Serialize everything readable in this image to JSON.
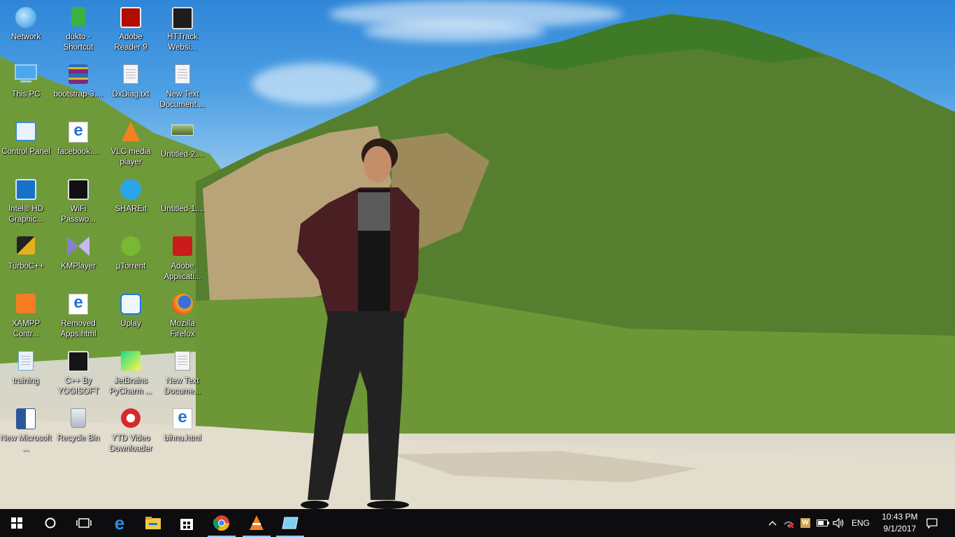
{
  "desktop": {
    "icons": [
      {
        "label": "Network"
      },
      {
        "label": "dukto - Shortcut"
      },
      {
        "label": "Adobe Reader 9"
      },
      {
        "label": "HTTrack Websi..."
      },
      {
        "label": "This PC"
      },
      {
        "label": "bootstrap-3...."
      },
      {
        "label": "DxDiag.txt"
      },
      {
        "label": "New Text Document...."
      },
      {
        "label": "Control Panel"
      },
      {
        "label": "facebook...."
      },
      {
        "label": "VLC media player"
      },
      {
        "label": "Untitled-2...."
      },
      {
        "label": "Intel® HD Graphic..."
      },
      {
        "label": "WiFi Passwo..."
      },
      {
        "label": "SHAREit"
      },
      {
        "label": "Untitled-1...."
      },
      {
        "label": "TurboC++"
      },
      {
        "label": "KMPlayer"
      },
      {
        "label": "µTorrent"
      },
      {
        "label": "Adobe Applicati..."
      },
      {
        "label": "XAMPP Contr..."
      },
      {
        "label": "Removed Apps.html"
      },
      {
        "label": "Uplay"
      },
      {
        "label": "Mozilla Firefox"
      },
      {
        "label": "training"
      },
      {
        "label": "C++ By YOGISOFT"
      },
      {
        "label": "JetBrains PyCharm ..."
      },
      {
        "label": "New Text Docume..."
      },
      {
        "label": "New Microsoft ..."
      },
      {
        "label": "Recycle Bin"
      },
      {
        "label": "YTD Video Downloader"
      },
      {
        "label": "bihnu.html"
      }
    ]
  },
  "taskbar": {
    "pinned": [
      "start-icon",
      "cortana-icon",
      "task-view-icon",
      "edge-icon",
      "file-explorer-icon",
      "store-icon",
      "chrome-icon",
      "vlc-icon",
      "app-icon"
    ],
    "tray": {
      "language": "ENG",
      "time": "10:43 PM",
      "date": "9/1/2017"
    }
  },
  "colors": {
    "taskbar_bg": "#0d0d0f",
    "accent": "#8ec8ff",
    "sky": "#4ea0e4",
    "hill": "#4f7a2b"
  }
}
